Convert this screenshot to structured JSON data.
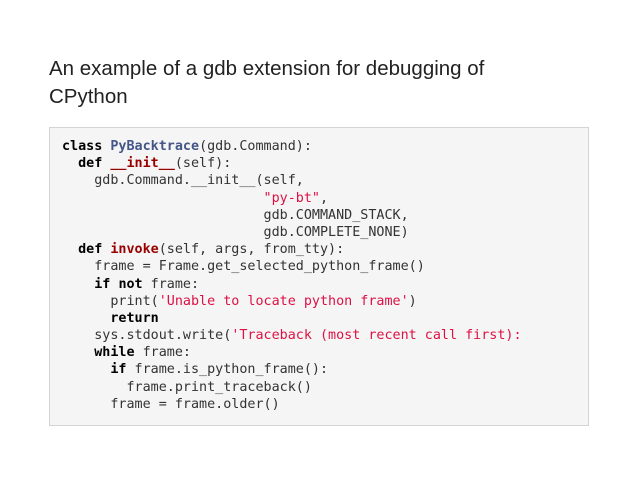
{
  "slide": {
    "title_lines": [
      "An example of a gdb extension for debugging of",
      "CPython"
    ]
  },
  "colors": {
    "background": "#ffffff",
    "code_background": "#f5f5f5",
    "code_border": "#d4d4d4",
    "keyword": "#000000",
    "class_name": "#445588",
    "function_name": "#990000",
    "string": "#dd1144",
    "plain": "#333333"
  },
  "code": {
    "lines": [
      [
        {
          "t": "kw",
          "v": "class"
        },
        {
          "t": "plain",
          "v": " "
        },
        {
          "t": "class",
          "v": "PyBacktrace"
        },
        {
          "t": "plain",
          "v": "(gdb.Command):"
        }
      ],
      [
        {
          "t": "plain",
          "v": "  "
        },
        {
          "t": "kw",
          "v": "def"
        },
        {
          "t": "plain",
          "v": " "
        },
        {
          "t": "func",
          "v": "__init__"
        },
        {
          "t": "plain",
          "v": "(self):"
        }
      ],
      [
        {
          "t": "plain",
          "v": "    gdb.Command.__init__(self,"
        }
      ],
      [
        {
          "t": "plain",
          "v": "                         "
        },
        {
          "t": "str",
          "v": "\"py-bt\""
        },
        {
          "t": "plain",
          "v": ","
        }
      ],
      [
        {
          "t": "plain",
          "v": "                         gdb.COMMAND_STACK,"
        }
      ],
      [
        {
          "t": "plain",
          "v": "                         gdb.COMPLETE_NONE)"
        }
      ],
      [
        {
          "t": "plain",
          "v": "  "
        },
        {
          "t": "kw",
          "v": "def"
        },
        {
          "t": "plain",
          "v": " "
        },
        {
          "t": "func",
          "v": "invoke"
        },
        {
          "t": "plain",
          "v": "(self, args, from_tty):"
        }
      ],
      [
        {
          "t": "plain",
          "v": "    frame = Frame.get_selected_python_frame()"
        }
      ],
      [
        {
          "t": "plain",
          "v": "    "
        },
        {
          "t": "kw",
          "v": "if"
        },
        {
          "t": "plain",
          "v": " "
        },
        {
          "t": "kw",
          "v": "not"
        },
        {
          "t": "plain",
          "v": " frame:"
        }
      ],
      [
        {
          "t": "plain",
          "v": "      print("
        },
        {
          "t": "str",
          "v": "'Unable to locate python frame'"
        },
        {
          "t": "plain",
          "v": ")"
        }
      ],
      [
        {
          "t": "plain",
          "v": "      "
        },
        {
          "t": "kw",
          "v": "return"
        }
      ],
      [
        {
          "t": "plain",
          "v": "    sys.stdout.write("
        },
        {
          "t": "str",
          "v": "'Traceback (most recent call first):"
        }
      ],
      [
        {
          "t": "plain",
          "v": "    "
        },
        {
          "t": "kw",
          "v": "while"
        },
        {
          "t": "plain",
          "v": " frame:"
        }
      ],
      [
        {
          "t": "plain",
          "v": "      "
        },
        {
          "t": "kw",
          "v": "if"
        },
        {
          "t": "plain",
          "v": " frame.is_python_frame():"
        }
      ],
      [
        {
          "t": "plain",
          "v": "        frame.print_traceback()"
        }
      ],
      [
        {
          "t": "plain",
          "v": "      frame = frame.older()"
        }
      ]
    ]
  }
}
